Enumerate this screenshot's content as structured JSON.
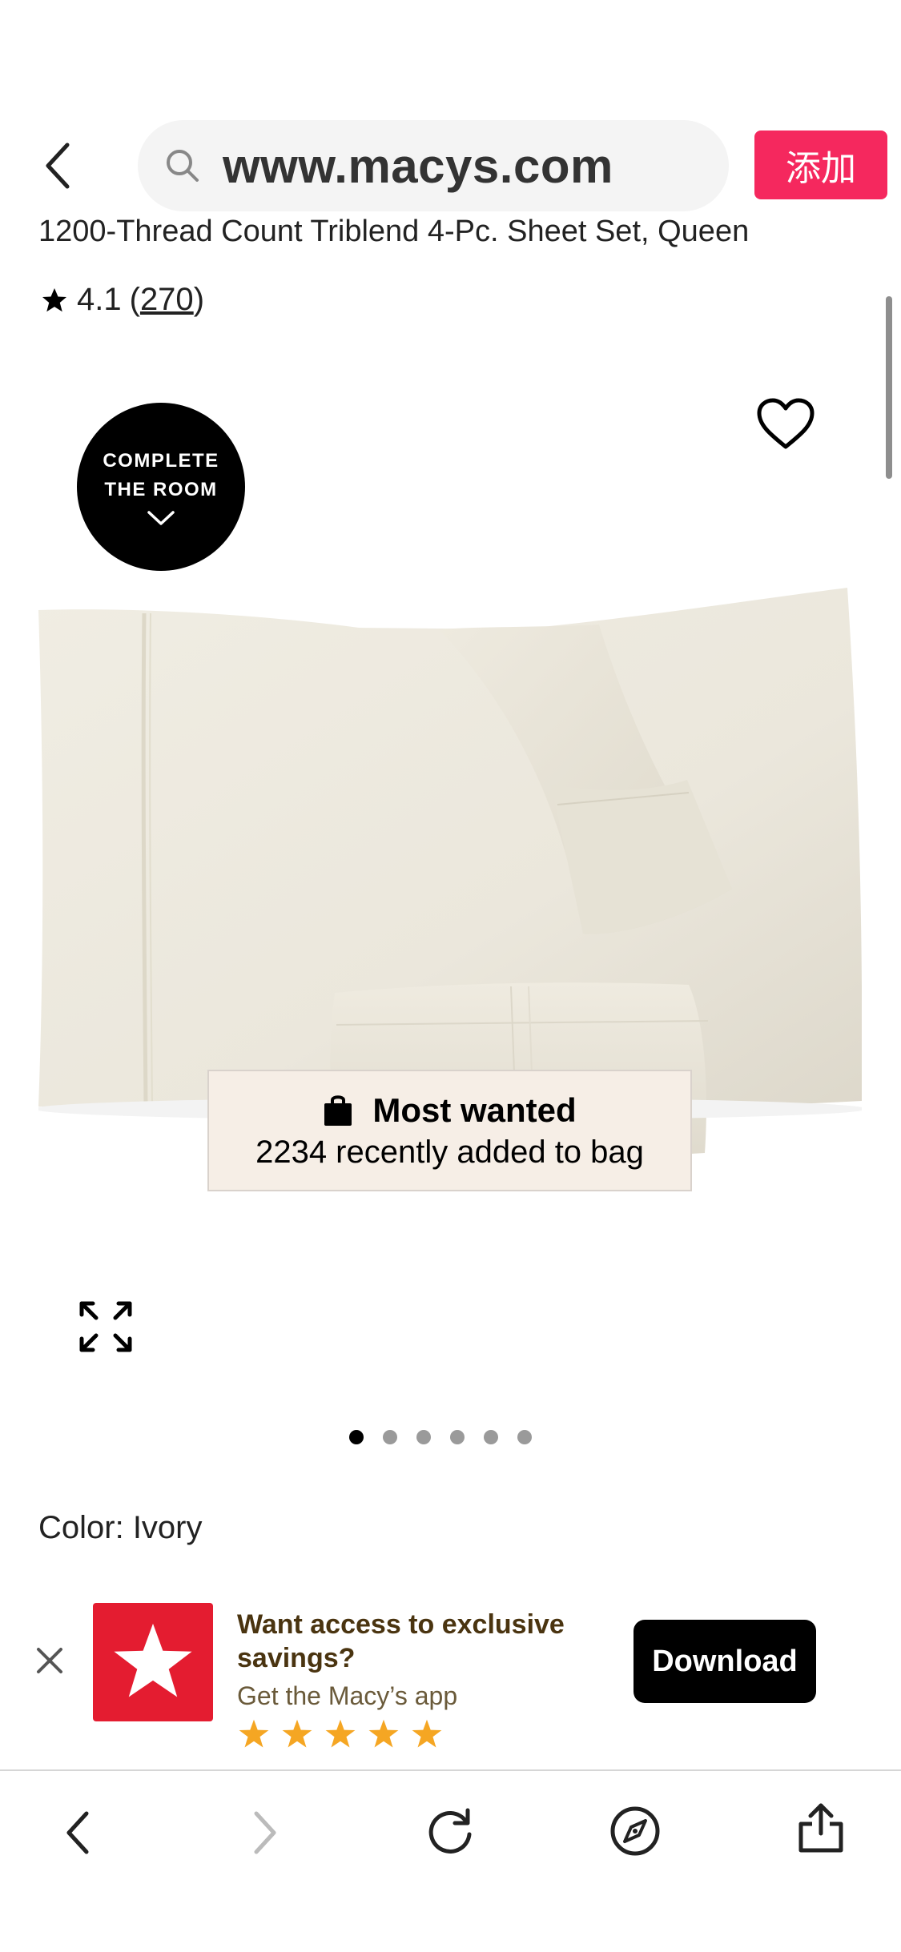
{
  "toolbar": {
    "url": "www.macys.com",
    "add_label": "添加",
    "back_icon": "chevron-left-icon",
    "search_icon": "search-icon"
  },
  "product": {
    "title": "1200-Thread Count Triblend 4-Pc. Sheet Set, Queen",
    "rating_value": "4.1",
    "rating_open": "(",
    "rating_count": "270",
    "rating_close": ")"
  },
  "image": {
    "badge_line1": "COMPLETE",
    "badge_line2": "THE ROOM",
    "most_wanted_title": "Most wanted",
    "most_wanted_sub": "2234 recently added to bag",
    "carousel_total": 6,
    "carousel_active": 1
  },
  "color": {
    "label": "Color: Ivory"
  },
  "promo": {
    "title": "Want access to exclusive savings?",
    "subtitle": "Get the Macy’s app",
    "stars": 5,
    "download_label": "Download"
  },
  "colors": {
    "accent": "#f5285e",
    "macys_red": "#e41c30",
    "star_orange": "#f5a623",
    "sheet_ivory": "#efece2"
  }
}
